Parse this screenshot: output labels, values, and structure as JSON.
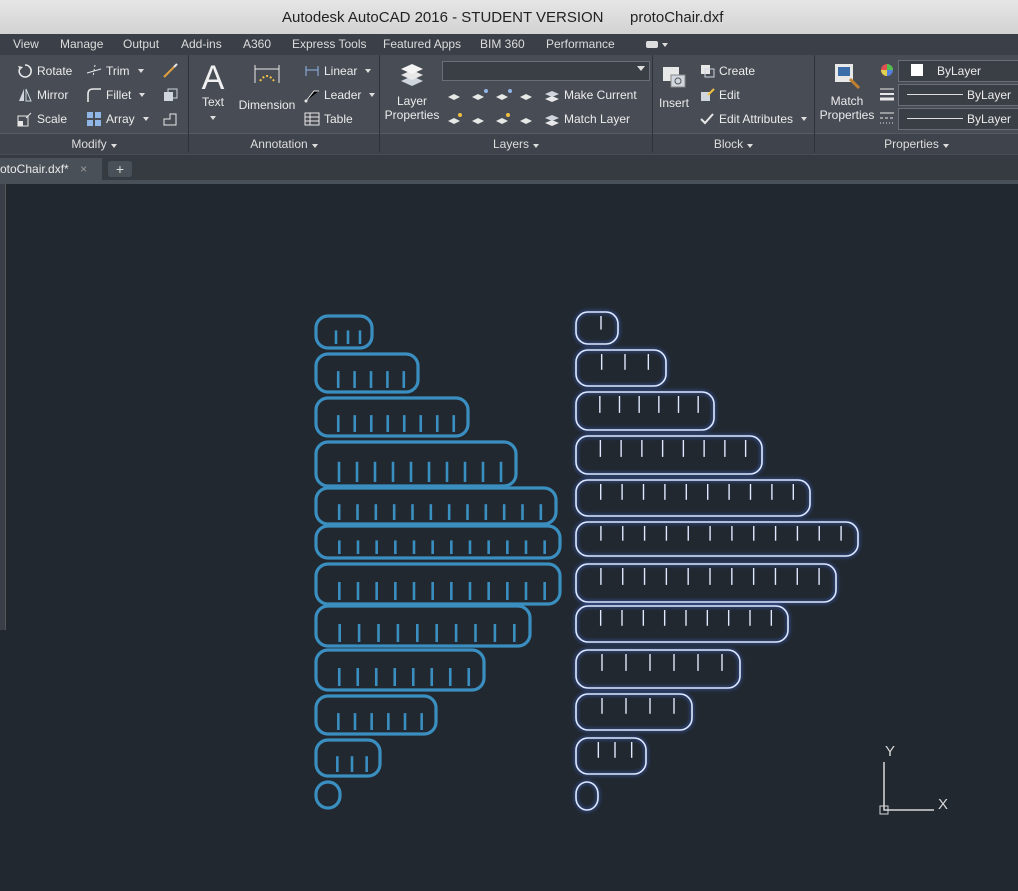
{
  "window": {
    "title": "Autodesk AutoCAD 2016 - STUDENT VERSION",
    "file": "protoChair.dxf"
  },
  "menu": [
    "View",
    "Manage",
    "Output",
    "Add-ins",
    "A360",
    "Express Tools",
    "Featured Apps",
    "BIM 360",
    "Performance"
  ],
  "modify": {
    "rotate": "Rotate",
    "mirror": "Mirror",
    "scale": "Scale",
    "trim": "Trim",
    "fillet": "Fillet",
    "array": "Array",
    "title": "Modify"
  },
  "annotation": {
    "text": "Text",
    "dimension": "Dimension",
    "linear": "Linear",
    "leader": "Leader",
    "table": "Table",
    "title": "Annotation"
  },
  "layers": {
    "layer_properties_1": "Layer",
    "layer_properties_2": "Properties",
    "make_current": "Make Current",
    "match_layer": "Match Layer",
    "title": "Layers"
  },
  "block": {
    "insert": "Insert",
    "create": "Create",
    "edit": "Edit",
    "edit_attributes": "Edit Attributes",
    "title": "Block"
  },
  "properties": {
    "match_1": "Match",
    "match_2": "Properties",
    "color": "ByLayer",
    "lineweight": "ByLayer",
    "linetype": "ByLayer",
    "title": "Properties"
  },
  "tab": {
    "name": "otoChair.dxf*",
    "close": "×",
    "add": "+"
  },
  "ucs": {
    "x": "X",
    "y": "Y"
  },
  "colors": {
    "left_parts": "#3a8fc0",
    "right_parts": "#dfe8ff",
    "background": "#212830"
  }
}
